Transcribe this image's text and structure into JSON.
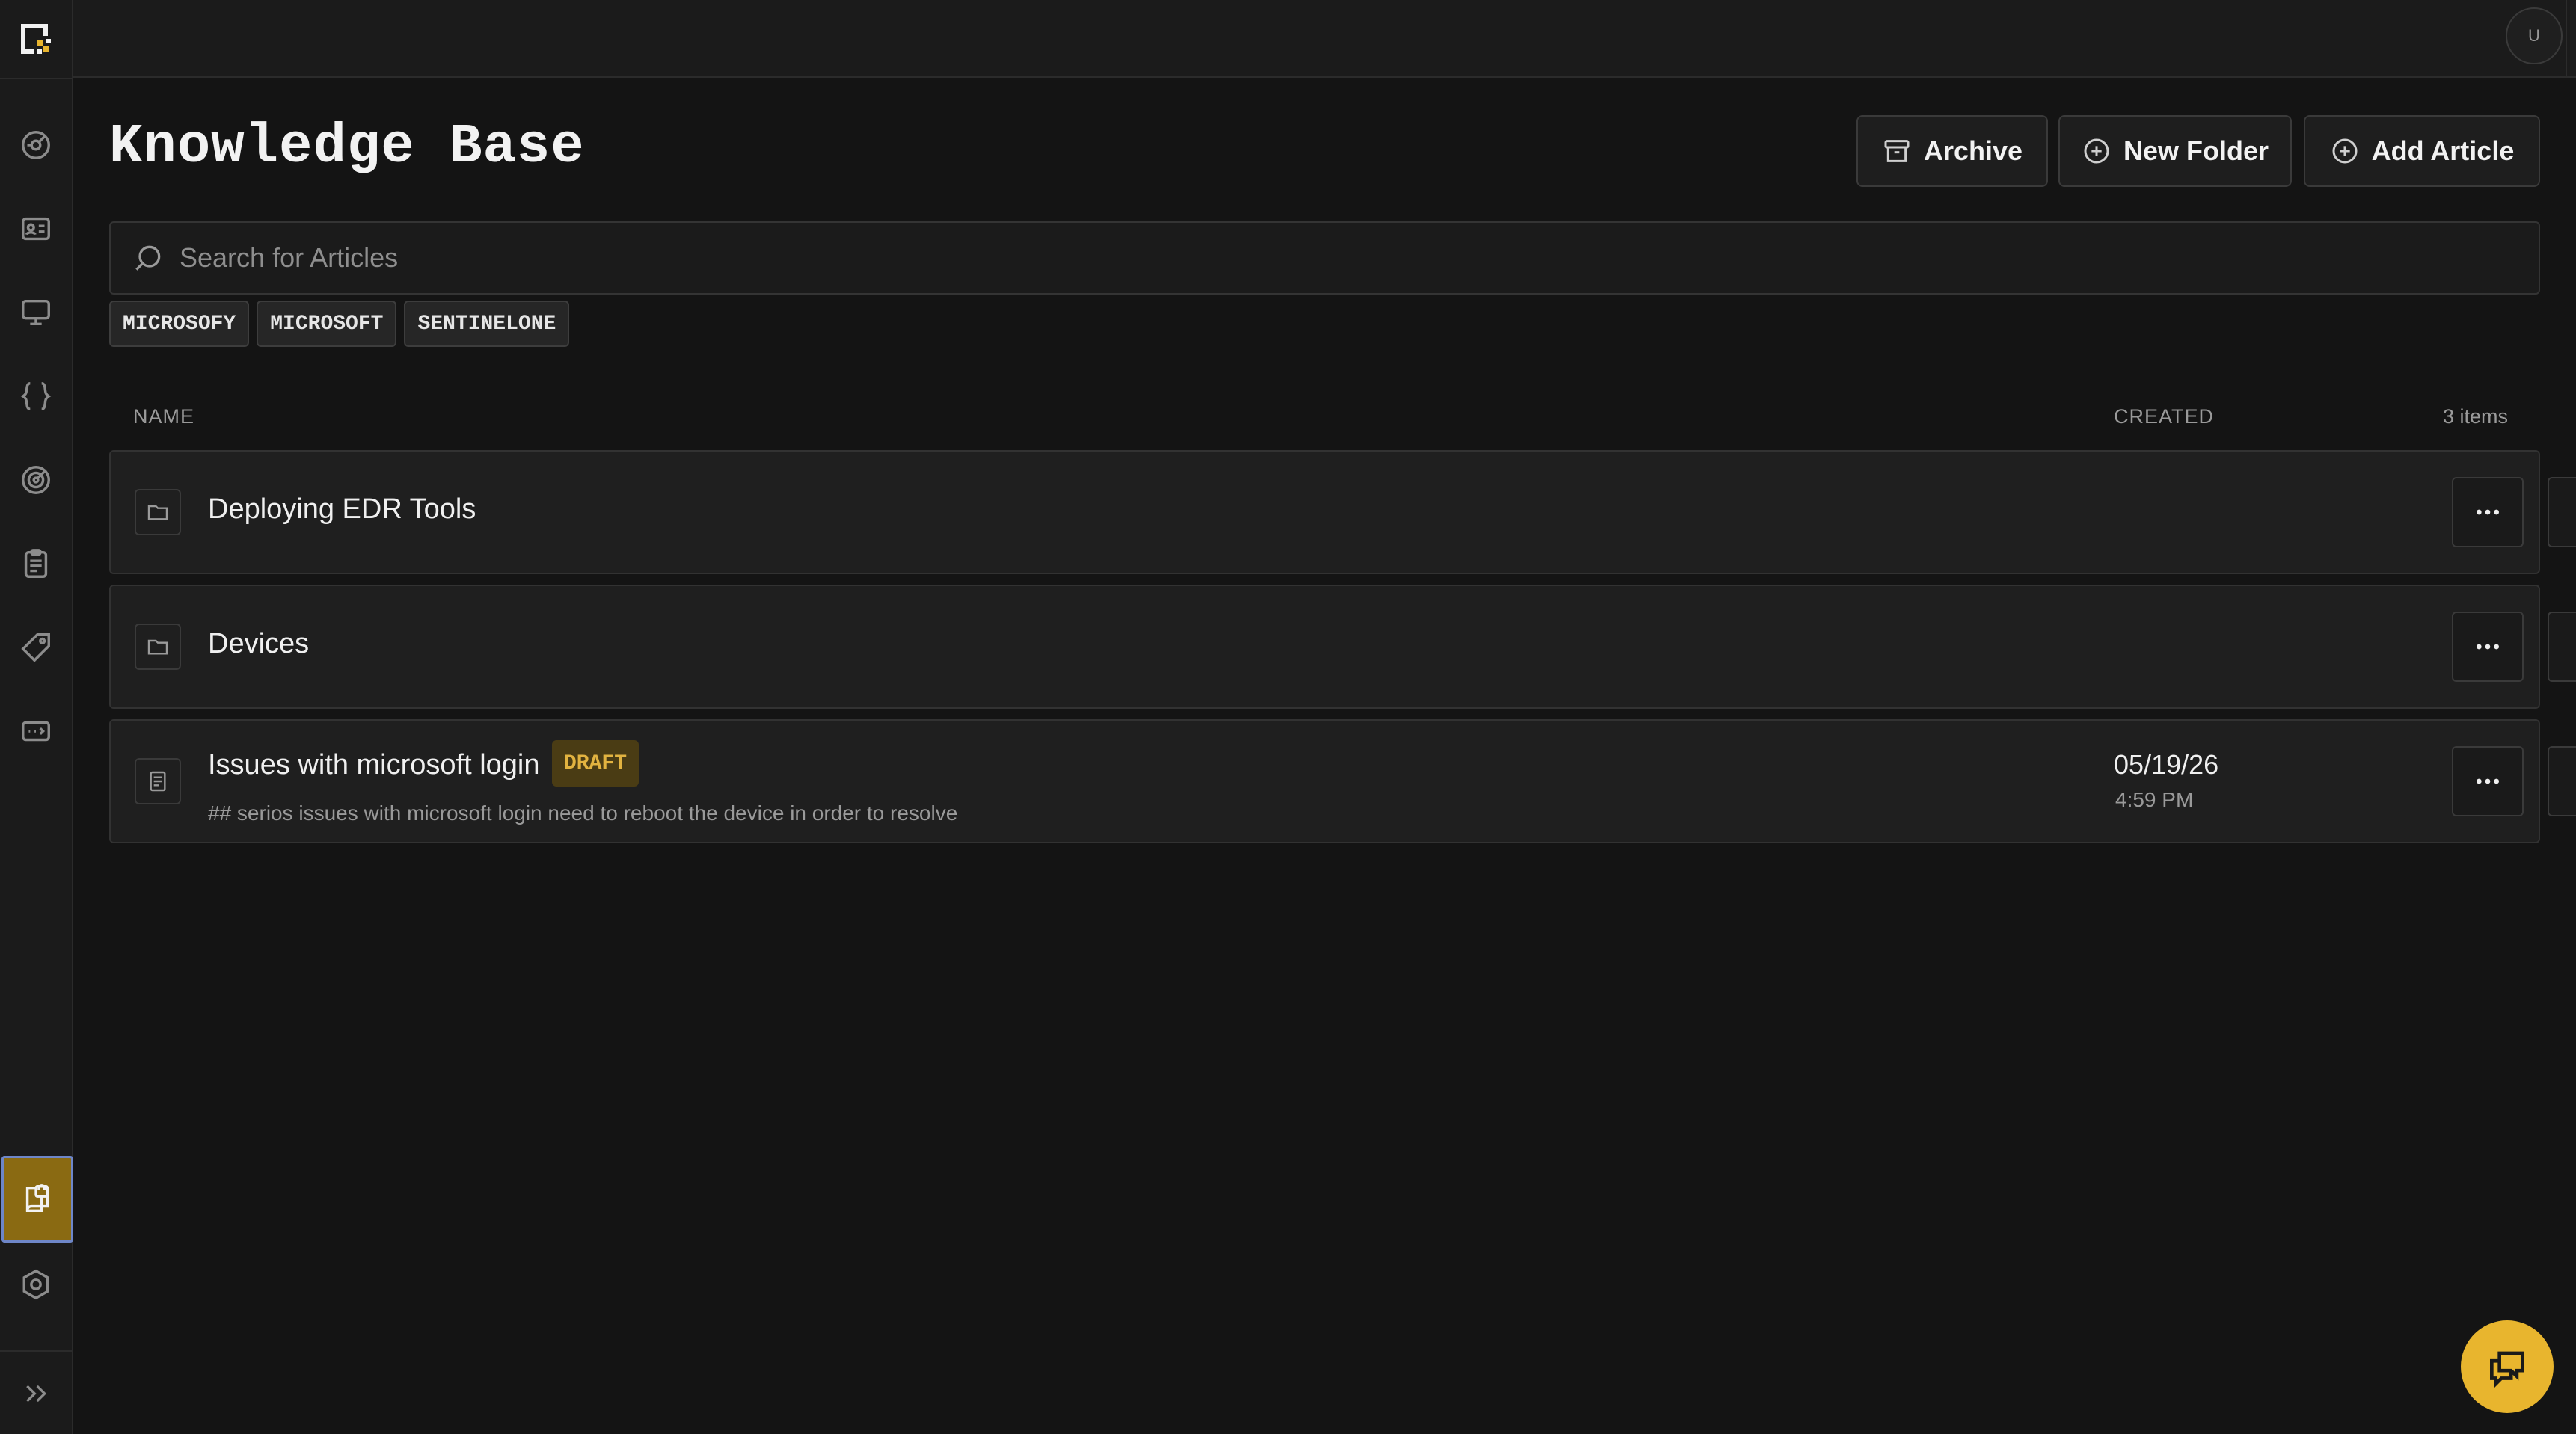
{
  "header": {
    "avatar_initial": "U"
  },
  "page": {
    "title": "Knowledge Base",
    "actions": {
      "archive": "Archive",
      "new_folder": "New Folder",
      "add_article": "Add Article"
    },
    "search": {
      "placeholder": "Search for Articles",
      "value": ""
    },
    "tags": [
      "MICROSOFY",
      "MICROSOFT",
      "SENTINELONE"
    ]
  },
  "table": {
    "columns": {
      "name": "NAME",
      "created": "CREATED"
    },
    "count_label": "3 items",
    "rows": [
      {
        "type": "folder",
        "title": "Deploying EDR Tools",
        "badge": "",
        "subtitle": "",
        "date": "",
        "time": ""
      },
      {
        "type": "folder",
        "title": "Devices",
        "badge": "",
        "subtitle": "",
        "date": "",
        "time": ""
      },
      {
        "type": "article",
        "title": "Issues with microsoft login",
        "badge": "DRAFT",
        "subtitle": "## serios issues with microsoft login need to reboot the device in order to resolve",
        "date": "05/19/26",
        "time": "4:59 PM"
      }
    ]
  },
  "sidebar": {
    "items": [
      {
        "icon": "dashboard-icon"
      },
      {
        "icon": "contact-card-icon"
      },
      {
        "icon": "monitor-icon"
      },
      {
        "icon": "code-braces-icon"
      },
      {
        "icon": "target-icon"
      },
      {
        "icon": "clipboard-list-icon"
      },
      {
        "icon": "tag-icon"
      },
      {
        "icon": "ticket-icon"
      },
      {
        "icon": "knowledge-base-icon",
        "active": true
      },
      {
        "icon": "settings-icon"
      }
    ],
    "expand_icon": "double-chevron-right-icon"
  },
  "colors": {
    "background": "#141414",
    "accent": "#e8b52e",
    "active_nav": "#8a6a12",
    "draft_badge_bg": "#4a3c14",
    "draft_badge_text": "#e2b340"
  }
}
